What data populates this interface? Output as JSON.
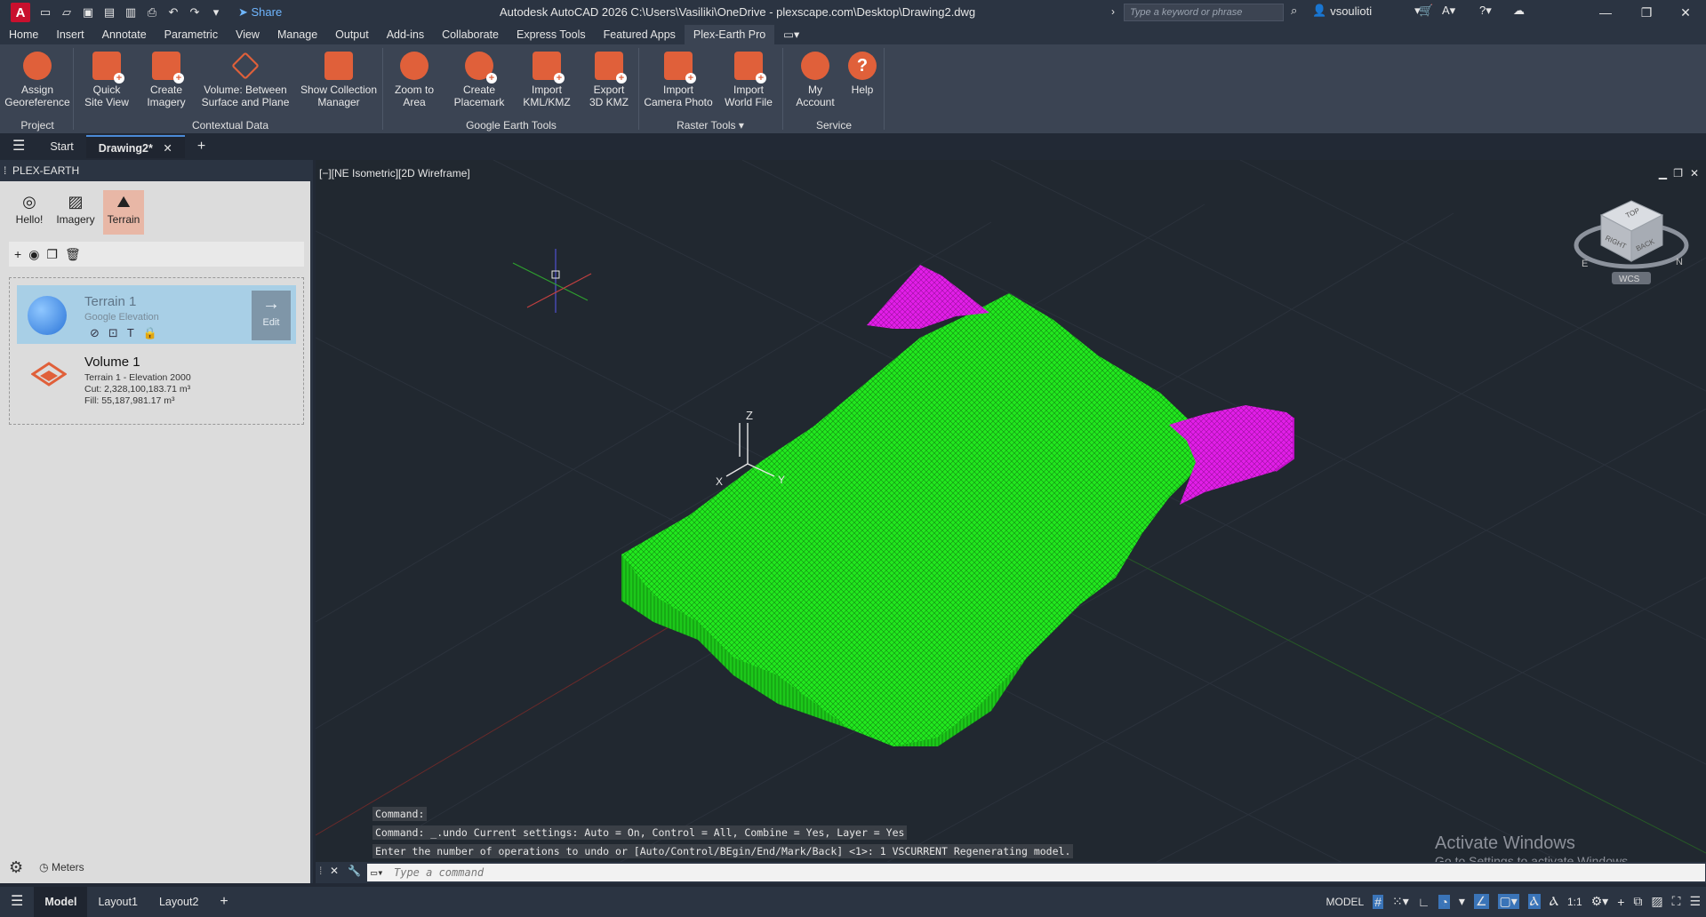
{
  "titlebar": {
    "app_letter": "A",
    "share_label": "Share",
    "title": "Autodesk AutoCAD 2026     C:\\Users\\Vasiliki\\OneDrive - plexscape.com\\Desktop\\Drawing2.dwg",
    "search_placeholder": "Type a keyword or phrase",
    "user": "vsoulioti"
  },
  "ribbon_tabs": [
    "Home",
    "Insert",
    "Annotate",
    "Parametric",
    "View",
    "Manage",
    "Output",
    "Add-ins",
    "Collaborate",
    "Express Tools",
    "Featured Apps",
    "Plex-Earth Pro"
  ],
  "ribbon": {
    "buttons": [
      {
        "l1": "Assign",
        "l2": "Georeference"
      },
      {
        "l1": "Quick",
        "l2": "Site View"
      },
      {
        "l1": "Create",
        "l2": "Imagery"
      },
      {
        "l1": "Volume: Between",
        "l2": "Surface and Plane"
      },
      {
        "l1": "Show Collection",
        "l2": "Manager"
      },
      {
        "l1": "Zoom to",
        "l2": "Area"
      },
      {
        "l1": "Create",
        "l2": "Placemark"
      },
      {
        "l1": "Import",
        "l2": "KML/KMZ"
      },
      {
        "l1": "Export",
        "l2": "3D KMZ"
      },
      {
        "l1": "Import",
        "l2": "Camera Photo"
      },
      {
        "l1": "Import",
        "l2": "World File"
      },
      {
        "l1": "My",
        "l2": "Account"
      },
      {
        "l1": "Help",
        "l2": ""
      }
    ],
    "groups": [
      "Project",
      "Contextual Data",
      "Google Earth Tools",
      "Raster Tools",
      "Service"
    ]
  },
  "file_tabs": [
    "Start",
    "Drawing2*"
  ],
  "palette": {
    "title": "PLEX-EARTH",
    "tabs": [
      "Hello!",
      "Imagery",
      "Terrain"
    ],
    "terrain": {
      "name": "Terrain 1",
      "source": "Google Elevation",
      "edit_label": "Edit"
    },
    "volume": {
      "name": "Volume 1",
      "ref": "Terrain 1 - Elevation 2000",
      "cut": "Cut: 2,328,100,183.71 m³",
      "fill": "Fill: 55,187,981.17 m³"
    },
    "units": "Meters"
  },
  "viewport": {
    "label": "[−][NE Isometric][2D Wireframe]",
    "wcs": "WCS",
    "axis_x": "X",
    "axis_y": "Y",
    "axis_z": "Z",
    "cube_top": "TOP",
    "cube_right": "RIGHT",
    "cube_back": "BACK",
    "compass_e": "E",
    "compass_n": "N",
    "colors": {
      "terrain": "#22e81f",
      "fill": "#e21ee8"
    }
  },
  "command": {
    "history": [
      "Command:",
      "Command:  _.undo Current settings: Auto = On, Control = All, Combine = Yes, Layer = Yes",
      "Enter the number of operations to undo or [Auto/Control/BEgin/End/Mark/Back] <1>: 1 VSCURRENT Regenerating model."
    ],
    "placeholder": "Type a command"
  },
  "watermark": {
    "line1": "Activate Windows",
    "line2": "Go to Settings to activate Windows."
  },
  "statusbar": {
    "tabs": [
      "Model",
      "Layout1",
      "Layout2"
    ],
    "model_label": "MODEL",
    "scale": "1:1"
  }
}
